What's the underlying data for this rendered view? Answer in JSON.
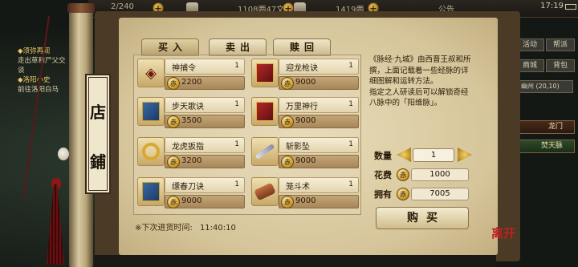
{
  "status": {
    "energy": "2/240",
    "money_a": "1108两47文",
    "money_b": "1419两",
    "announce": "公告",
    "time": "17:19"
  },
  "left_quest": {
    "q1_title": "须弥再现",
    "q1_desc": "走出草和尸父交谈",
    "q2_title": "洛阳小史",
    "q2_desc": "前往洛阳白马"
  },
  "right_menu": {
    "activity": "活动",
    "bang": "帮派",
    "shop": "商城",
    "bag": "背包",
    "location": "幽州",
    "coords": "(20,10)",
    "btn_gate": "龙门",
    "btn_tian": "焚天脉"
  },
  "shop": {
    "plaque_1": "店",
    "plaque_2": "鋪",
    "tabs": [
      "买入",
      "卖出",
      "赎回"
    ],
    "active_tab": 0,
    "currency_icon": "coin-icon",
    "restock_label": "※下次进货时间:",
    "restock_time": "11:40:10",
    "items": [
      {
        "name": "神捕令",
        "qty": "1",
        "price": "2200",
        "icon": "token"
      },
      {
        "name": "迎龙枪诀",
        "qty": "1",
        "price": "9000",
        "icon": "book-red"
      },
      {
        "name": "步天歌诀",
        "qty": "1",
        "price": "3500",
        "icon": "book-blue"
      },
      {
        "name": "万里神行",
        "qty": "1",
        "price": "9000",
        "icon": "book-red"
      },
      {
        "name": "龙虎扳指",
        "qty": "1",
        "price": "3200",
        "icon": "ring"
      },
      {
        "name": "斩影坠",
        "qty": "1",
        "price": "9000",
        "icon": "blade"
      },
      {
        "name": "缥春刀诀",
        "qty": "1",
        "price": "9000",
        "icon": "book-blue"
      },
      {
        "name": "笼斗术",
        "qty": "1",
        "price": "9000",
        "icon": "scroll"
      }
    ]
  },
  "detail": {
    "description_1": "《脉经·九城》由西晋王叔和所撰，上面记载着一些经脉的详细图解和运转方法。",
    "description_2": "指定之人研读后可以解锁奇经八脉中的「阳维脉」。",
    "qty_label": "数量",
    "qty_value": "1",
    "cost_label": "花费",
    "cost_value": "1000",
    "own_label": "拥有",
    "own_value": "7005",
    "buy_label": "购买",
    "close_label": "离开"
  }
}
